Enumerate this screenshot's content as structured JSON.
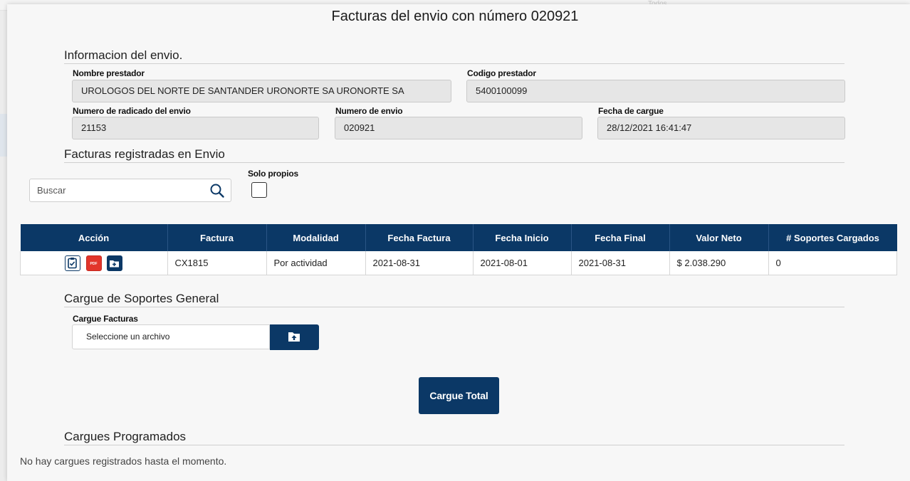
{
  "modal": {
    "title": "Facturas del envio con número 020921"
  },
  "info": {
    "section_title": "Informacion del envio.",
    "nombre_prestador_label": "Nombre prestador",
    "nombre_prestador_value": "UROLOGOS DEL NORTE DE SANTANDER URONORTE SA URONORTE SA",
    "codigo_prestador_label": "Codigo prestador",
    "codigo_prestador_value": "5400100099",
    "radicado_label": "Numero de radicado del envio",
    "radicado_value": "21153",
    "numero_envio_label": "Numero de envio",
    "numero_envio_value": "020921",
    "fecha_cargue_label": "Fecha de cargue",
    "fecha_cargue_value": "28/12/2021 16:41:47"
  },
  "facturas": {
    "section_title": "Facturas registradas en Envio",
    "search_placeholder": "Buscar",
    "solo_propios_label": "Solo propios",
    "solo_propios_checked": false,
    "columns": [
      "Acción",
      "Factura",
      "Modalidad",
      "Fecha Factura",
      "Fecha Inicio",
      "Fecha Final",
      "Valor Neto",
      "# Soportes Cargados"
    ],
    "rows": [
      {
        "actions": [
          "clipboard-check-icon",
          "pdf-file-icon",
          "add-folder-icon"
        ],
        "factura": "CX1815",
        "modalidad": "Por actividad",
        "fecha_factura": "2021-08-31",
        "fecha_inicio": "2021-08-01",
        "fecha_final": "2021-08-31",
        "valor_neto": "$ 2.038.290",
        "soportes": "0"
      }
    ]
  },
  "soportes": {
    "section_title": "Cargue de Soportes General",
    "cargue_label": "Cargue Facturas",
    "file_placeholder": "Seleccione un archivo",
    "upload_icon": "folder-upload-icon",
    "total_button": "Cargue Total"
  },
  "programados": {
    "section_title": "Cargues Programados",
    "empty_message": "No hay cargues registrados hasta el momento."
  },
  "background": {
    "ghost_select_text": "Todos"
  },
  "colors": {
    "primary": "#0b3866",
    "pdf_red": "#e2352b",
    "field_bg": "#e6e6e6"
  }
}
